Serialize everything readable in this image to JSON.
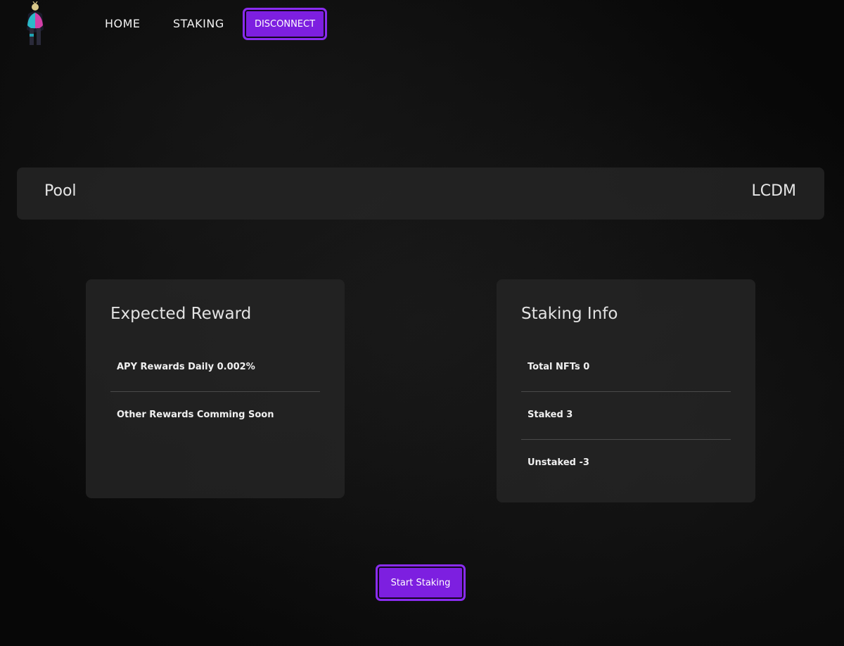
{
  "nav": {
    "home_label": "HOME",
    "staking_label": "STAKING",
    "disconnect_label": "DISCONNECT"
  },
  "pool": {
    "label": "Pool",
    "value": "LCDM"
  },
  "expected_reward": {
    "title": "Expected Reward",
    "rows": [
      "APY Rewards Daily 0.002%",
      "Other Rewards Comming Soon"
    ]
  },
  "staking_info": {
    "title": "Staking Info",
    "rows": [
      "Total NFTs 0",
      "Staked 3",
      "Unstaked -3"
    ]
  },
  "start_button_label": "Start Staking",
  "colors": {
    "accent_purple": "#7d1fe0",
    "background": "#0c0c0c",
    "card": "#262626"
  }
}
